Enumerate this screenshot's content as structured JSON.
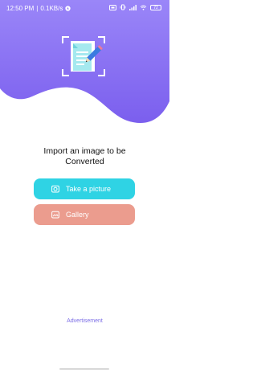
{
  "status_bar": {
    "time": "12:50 PM",
    "speed": "0.1KB/s",
    "battery": "72"
  },
  "main": {
    "heading_line1": "Import an image to be",
    "heading_line2": "Converted"
  },
  "actions": {
    "camera_label": "Take a picture",
    "gallery_label": "Gallery"
  },
  "footer": {
    "ad_label": "Advertisement"
  },
  "colors": {
    "hero_gradient_start": "#8f7af7",
    "hero_gradient_end": "#7d62ef",
    "camera_button": "#2fd3e4",
    "gallery_button": "#eb9c8e",
    "ad_text": "#7b6de6"
  },
  "icons": [
    "navigation-icon",
    "sim-icon",
    "vibrate-icon",
    "signal-icon",
    "wifi-icon",
    "battery-icon",
    "camera-icon",
    "gallery-icon",
    "document-edit-icon"
  ]
}
